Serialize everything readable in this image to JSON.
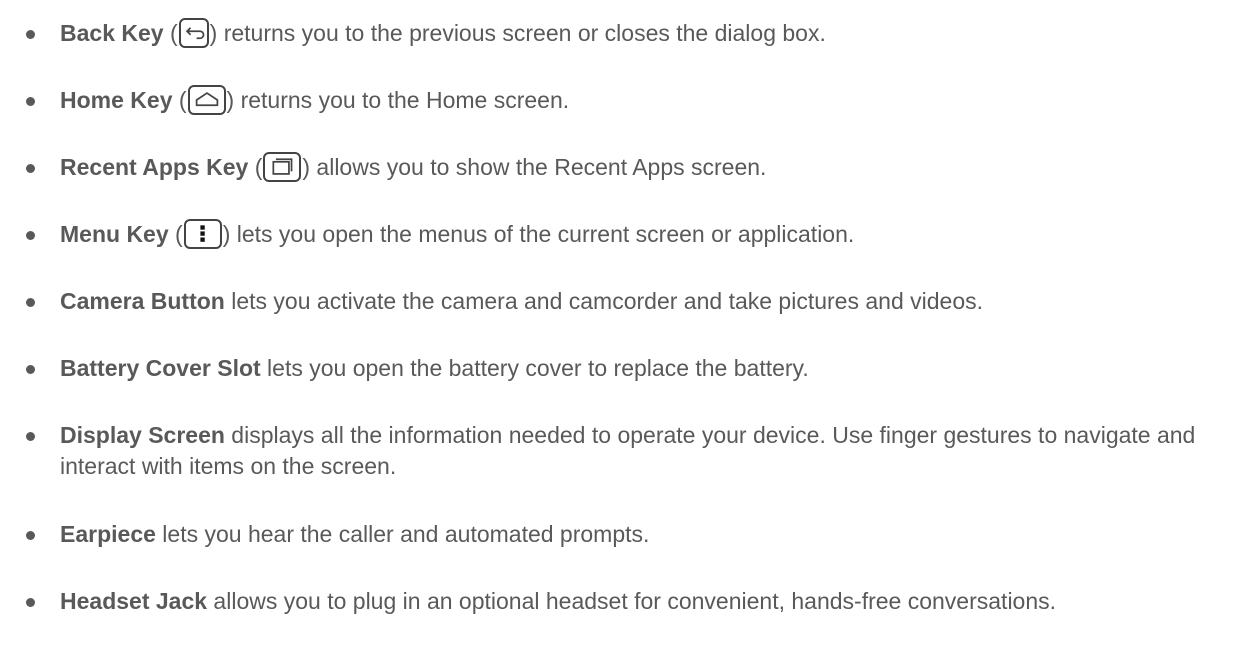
{
  "items": [
    {
      "term": "Back Key",
      "icon": "back-arrow-icon",
      "pre": " (",
      "post": ") returns you to the previous screen or closes the dialog box."
    },
    {
      "term": "Home Key",
      "icon": "home-icon",
      "pre": " (",
      "post": ") returns you to the Home screen."
    },
    {
      "term": "Recent Apps Key",
      "icon": "recent-apps-icon",
      "pre": " (",
      "post": ") allows you to show the Recent Apps screen."
    },
    {
      "term": "Menu Key",
      "icon": "menu-dots-icon",
      "pre": " (",
      "post": ") lets you open the menus of the current screen or application."
    },
    {
      "term": "Camera Button",
      "text": " lets you activate the camera and camcorder and take pictures and videos."
    },
    {
      "term": "Battery Cover Slot",
      "text": " lets you open the battery cover to replace the battery."
    },
    {
      "term": "Display Screen",
      "text": " displays all the information needed to operate your device. Use finger gestures to navigate and interact with items on the screen."
    },
    {
      "term": "Earpiece",
      "text": " lets you hear the caller and automated prompts."
    },
    {
      "term": "Headset Jack",
      "text": " allows you to plug in an optional headset for convenient, hands-free conversations."
    }
  ],
  "colors": {
    "text": "#595959",
    "icon_border": "#444444"
  }
}
